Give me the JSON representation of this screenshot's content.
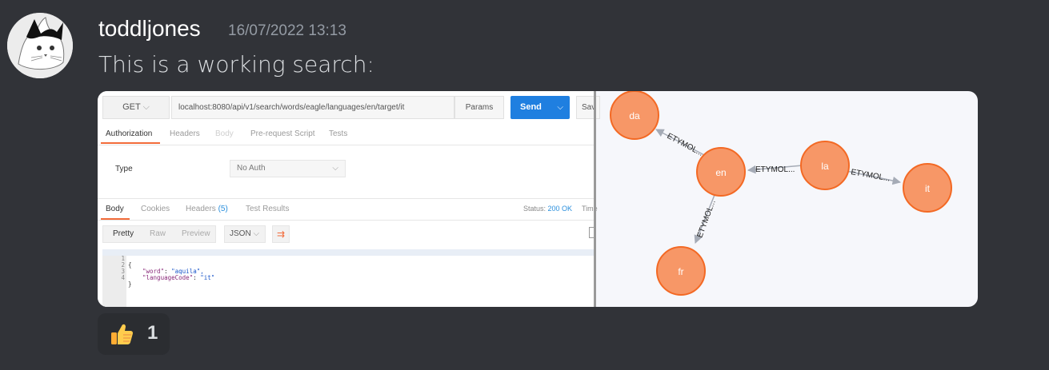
{
  "author": {
    "username": "toddljones",
    "timestamp": "16/07/2022 13:13"
  },
  "message": {
    "text": "This is a working search:"
  },
  "postman": {
    "method": "GET",
    "url": "localhost:8080/api/v1/search/words/eagle/languages/en/target/it",
    "params_label": "Params",
    "send_label": "Send",
    "save_label": "Sav",
    "request_tabs": [
      "Authorization",
      "Headers",
      "Body",
      "Pre-request Script",
      "Tests"
    ],
    "auth_type_label": "Type",
    "auth_type_value": "No Auth",
    "response_tabs": [
      "Body",
      "Cookies",
      "Headers",
      "Test Results"
    ],
    "headers_count": "(5)",
    "status_label": "Status:",
    "status_value": "200 OK",
    "time_label": "Time",
    "view_options": [
      "Pretty",
      "Raw",
      "Preview"
    ],
    "format": "JSON",
    "code_lines": [
      {
        "n": "1",
        "text": "{"
      },
      {
        "n": "2",
        "key": "\"word\"",
        "value": "\"aquila\","
      },
      {
        "n": "3",
        "key": "\"languageCode\"",
        "value": "\"it\""
      },
      {
        "n": "4",
        "text": "}"
      }
    ]
  },
  "graph": {
    "node_color": "#f79767",
    "node_border": "#f36924",
    "nodes": [
      "da",
      "en",
      "la",
      "it",
      "fr"
    ],
    "edge_label": "ETYMOL..."
  },
  "reaction": {
    "emoji": "thumbs-up",
    "count": "1"
  }
}
